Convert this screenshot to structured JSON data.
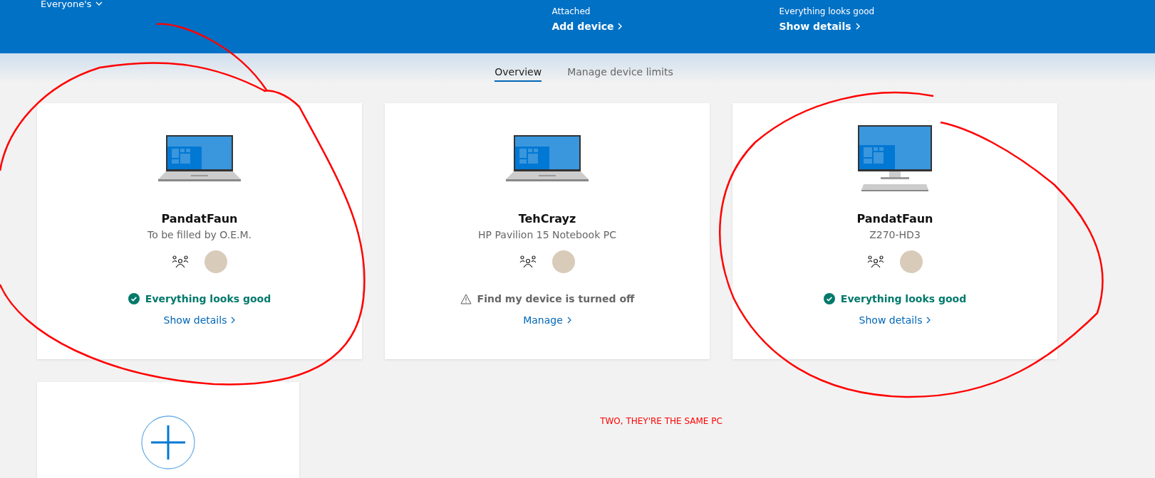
{
  "header": {
    "account_menu": "Everyone's",
    "columns": [
      {
        "subtitle": "Attached",
        "link": "Add device"
      },
      {
        "subtitle": "Everything looks good",
        "link": "Show details"
      }
    ]
  },
  "tabs": [
    {
      "label": "Overview",
      "selected": true
    },
    {
      "label": "Manage device limits",
      "selected": false
    }
  ],
  "devices": [
    {
      "kind": "laptop",
      "name": "PandatFaun",
      "model": "To be filled by O.E.M.",
      "status": {
        "kind": "ok",
        "text": "Everything looks good"
      },
      "link": "Show details"
    },
    {
      "kind": "laptop",
      "name": "TehCrayz",
      "model": "HP Pavilion 15 Notebook PC",
      "status": {
        "kind": "warning",
        "text": "Find my device is turned off"
      },
      "link": "Manage"
    },
    {
      "kind": "desktop",
      "name": "PandatFaun",
      "model": "Z270-HD3",
      "status": {
        "kind": "ok",
        "text": "Everything looks good"
      },
      "link": "Show details"
    }
  ],
  "annotation": {
    "note": "TWO, THEY'RE THE SAME PC"
  }
}
